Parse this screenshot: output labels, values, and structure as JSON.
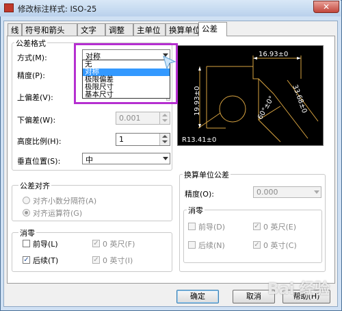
{
  "window": {
    "title": "修改标注样式: ISO-25",
    "close_glyph": "✕"
  },
  "tabs": [
    "线",
    "符号和箭头",
    "文字",
    "调整",
    "主单位",
    "换算单位",
    "公差"
  ],
  "tolerance": {
    "group_title": "公差格式",
    "method_label": "方式(M):",
    "method_value": "对称",
    "precision_label": "精度(P):",
    "upper_label": "上偏差(V):",
    "lower_label": "下偏差(W):",
    "lower_value": "0.001",
    "height_label": "高度比例(H):",
    "height_value": "1",
    "vpos_label": "垂直位置(S):",
    "vpos_value": "中",
    "method_options": [
      "无",
      "对称",
      "极限偏差",
      "极限尺寸",
      "基本尺寸"
    ],
    "method_selected_index": 1
  },
  "alignment": {
    "group_title": "公差对齐",
    "opt1": "对齐小数分隔符(A)",
    "opt2": "对齐运算符(G)"
  },
  "zero_left": {
    "group_title": "消零",
    "leading": "前导(L)",
    "leading_checked": false,
    "trailing": "后续(T)",
    "trailing_checked": true,
    "feet": "0 英尺(F)",
    "inches": "0 英寸(I)",
    "check_glyph": "✓"
  },
  "alt": {
    "group_title": "换算单位公差",
    "precision_label": "精度(O):",
    "precision_value": "0.000",
    "zero_title": "消零",
    "leading": "前导(D)",
    "trailing": "后续(N)",
    "feet": "0 英尺(E)",
    "inches": "0 英寸(C)"
  },
  "preview": {
    "dim_top": "16.93±0",
    "dim_left": "19.93±0",
    "dim_right": "33.68±0",
    "dim_angle": "60°±0°",
    "dim_radius": "R13.41±0",
    "line_color": "#d9a441",
    "text_color": "#ffffff"
  },
  "buttons": {
    "ok": "确定",
    "cancel": "取消",
    "help": "帮助(H)"
  },
  "watermark": "Bai 经验"
}
